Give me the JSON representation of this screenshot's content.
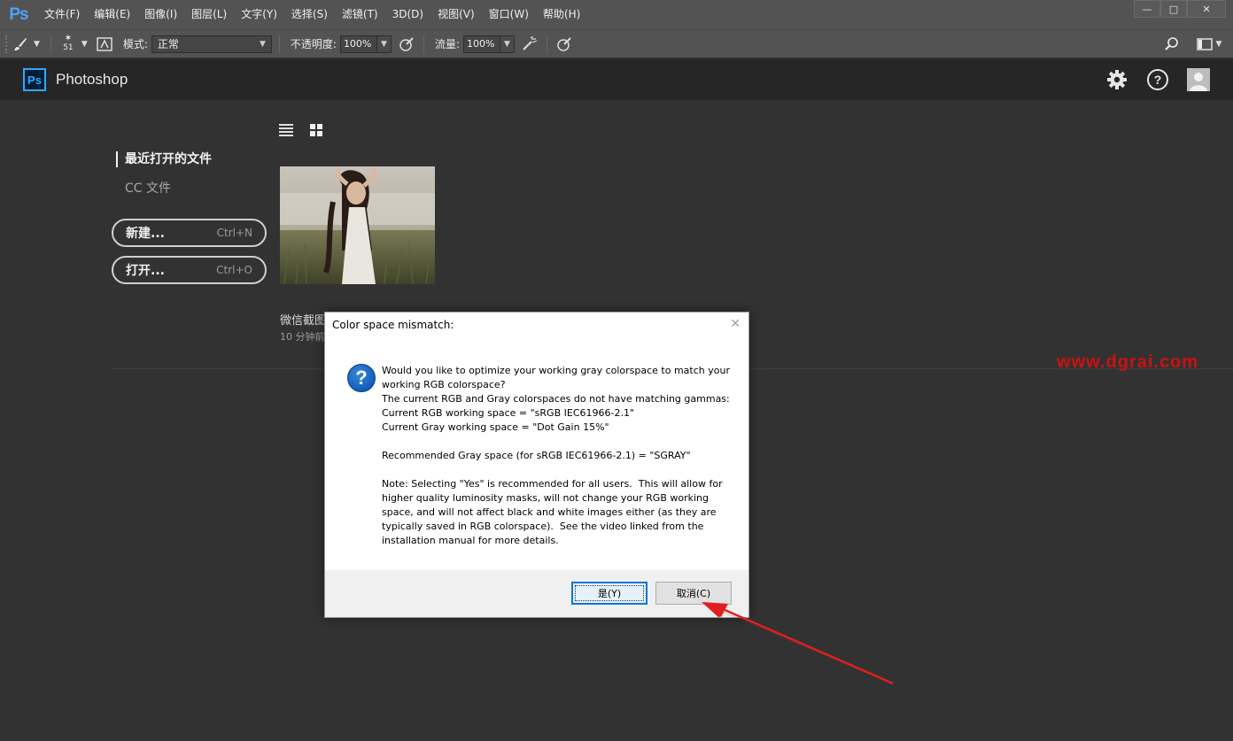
{
  "app": {
    "logo": "Ps",
    "menu": [
      "文件(F)",
      "编辑(E)",
      "图像(I)",
      "图层(L)",
      "文字(Y)",
      "选择(S)",
      "滤镜(T)",
      "3D(D)",
      "视图(V)",
      "窗口(W)",
      "帮助(H)"
    ],
    "window_controls": {
      "minimize": "—",
      "maximize": "□",
      "close": "✕"
    }
  },
  "options_bar": {
    "brush_size": "51",
    "mode_label": "模式:",
    "mode_value": "正常",
    "opacity_label": "不透明度:",
    "opacity_value": "100%",
    "flow_label": "流量:",
    "flow_value": "100%"
  },
  "workspace": {
    "logo": "Ps",
    "title": "Photoshop",
    "nav": {
      "recent": "最近打开的文件",
      "cc_files": "CC 文件"
    },
    "buttons": {
      "new_label": "新建...",
      "new_shortcut": "Ctrl+N",
      "open_label": "打开...",
      "open_shortcut": "Ctrl+O"
    },
    "recent_file": {
      "name": "微信截图",
      "time": "10 分钟前"
    },
    "watermark": "www.dgrai.com"
  },
  "dialog": {
    "title": "Color space mismatch:",
    "icon": "question-icon",
    "message": "Would you like to optimize your working gray colorspace to match your working RGB colorspace?\nThe current RGB and Gray colorspaces do not have matching gammas:\nCurrent RGB working space = \"sRGB IEC61966-2.1\"\nCurrent Gray working space = \"Dot Gain 15%\"\n\nRecommended Gray space (for sRGB IEC61966-2.1) = \"SGRAY\"\n\nNote: Selecting \"Yes\" is recommended for all users.  This will allow for higher quality luminosity masks, will not change your RGB working space, and will not affect black and white images either (as they are typically saved in RGB colorspace).  See the video linked from the installation manual for more details.",
    "yes_button": "是(Y)",
    "cancel_button": "取消(C)"
  },
  "colors": {
    "ps_blue": "#31a8ff",
    "annotation_arrow": "#e02020",
    "watermark": "#cc1111"
  }
}
